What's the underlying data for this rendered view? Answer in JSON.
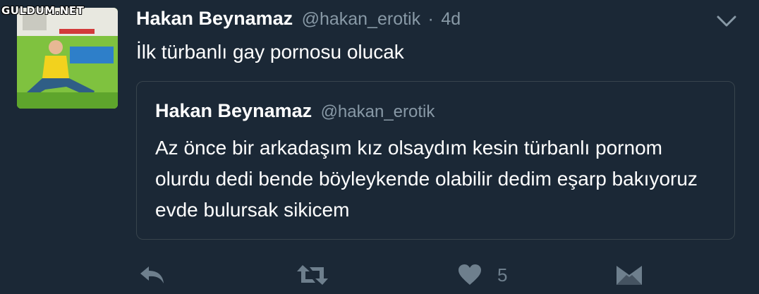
{
  "watermark": "GULDUM.NET",
  "tweet": {
    "display_name": "Hakan Beynamaz",
    "handle": "@hakan_erotik",
    "separator": "·",
    "time": "4d",
    "text": "İlk türbanlı gay pornosu olucak"
  },
  "quoted_tweet": {
    "display_name": "Hakan Beynamaz",
    "handle": "@hakan_erotik",
    "text": "Az önce bir arkadaşım kız olsaydım kesin türbanlı pornom olurdu dedi bende böyleykende olabilir dedim eşarp bakıyoruz evde bulursak sikicem"
  },
  "actions": {
    "reply_icon": "reply-icon",
    "retweet_icon": "retweet-icon",
    "like_icon": "heart-icon",
    "like_count": "5",
    "dm_icon": "envelope-icon"
  },
  "colors": {
    "background": "#1b2836",
    "muted_text": "#8899a6",
    "border": "#38444d",
    "icon": "#6e7f8d"
  }
}
